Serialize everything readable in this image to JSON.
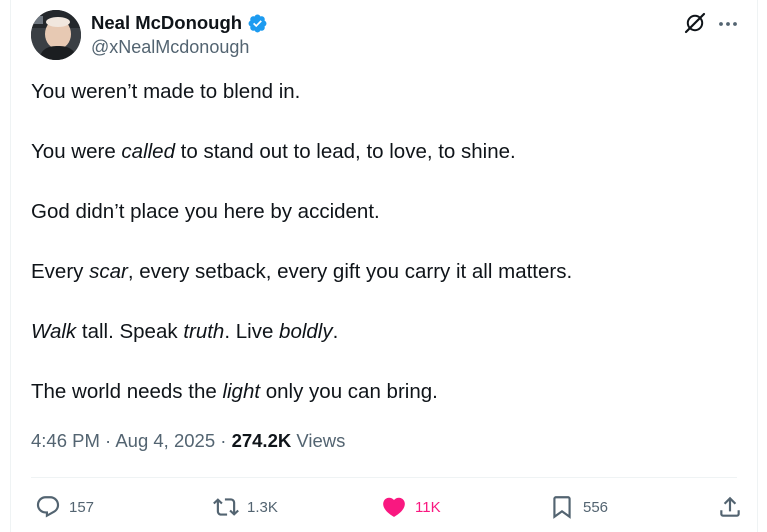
{
  "author": {
    "display_name": "Neal McDonough",
    "handle": "@xNealMcdonough",
    "verified": true
  },
  "tweet": {
    "paragraphs": [
      [
        {
          "t": "You weren’t made to blend in.",
          "i": false
        }
      ],
      [
        {
          "t": "You were ",
          "i": false
        },
        {
          "t": "called",
          "i": true
        },
        {
          "t": " to stand out to lead, to love, to shine.",
          "i": false
        }
      ],
      [
        {
          "t": "God didn’t place you here by accident.",
          "i": false
        }
      ],
      [
        {
          "t": "Every ",
          "i": false
        },
        {
          "t": "scar",
          "i": true
        },
        {
          "t": ", every setback, every gift you carry it all matters.",
          "i": false
        }
      ],
      [
        {
          "t": "Walk",
          "i": true
        },
        {
          "t": " tall. Speak ",
          "i": false
        },
        {
          "t": "truth",
          "i": true
        },
        {
          "t": ". Live ",
          "i": false
        },
        {
          "t": "boldly",
          "i": true
        },
        {
          "t": ".",
          "i": false
        }
      ],
      [
        {
          "t": "The world needs the ",
          "i": false
        },
        {
          "t": "light",
          "i": true
        },
        {
          "t": " only you can bring.",
          "i": false
        }
      ]
    ]
  },
  "meta": {
    "time": "4:46 PM",
    "separator": " · ",
    "date": "Aug 4, 2025",
    "views_count": "274.2K",
    "views_label": " Views"
  },
  "actions": {
    "replies": "157",
    "reposts": "1.3K",
    "likes": "11K",
    "bookmarks": "556"
  },
  "icons": {
    "verified": "verified-badge-icon",
    "grok": "grok-icon",
    "more": "more-icon",
    "reply": "reply-icon",
    "repost": "repost-icon",
    "like": "heart-icon",
    "bookmark": "bookmark-icon",
    "share": "share-icon"
  },
  "colors": {
    "verified_blue": "#1d9bf0",
    "like_pink": "#f91880",
    "text_primary": "#0f1419",
    "text_secondary": "#536471"
  }
}
